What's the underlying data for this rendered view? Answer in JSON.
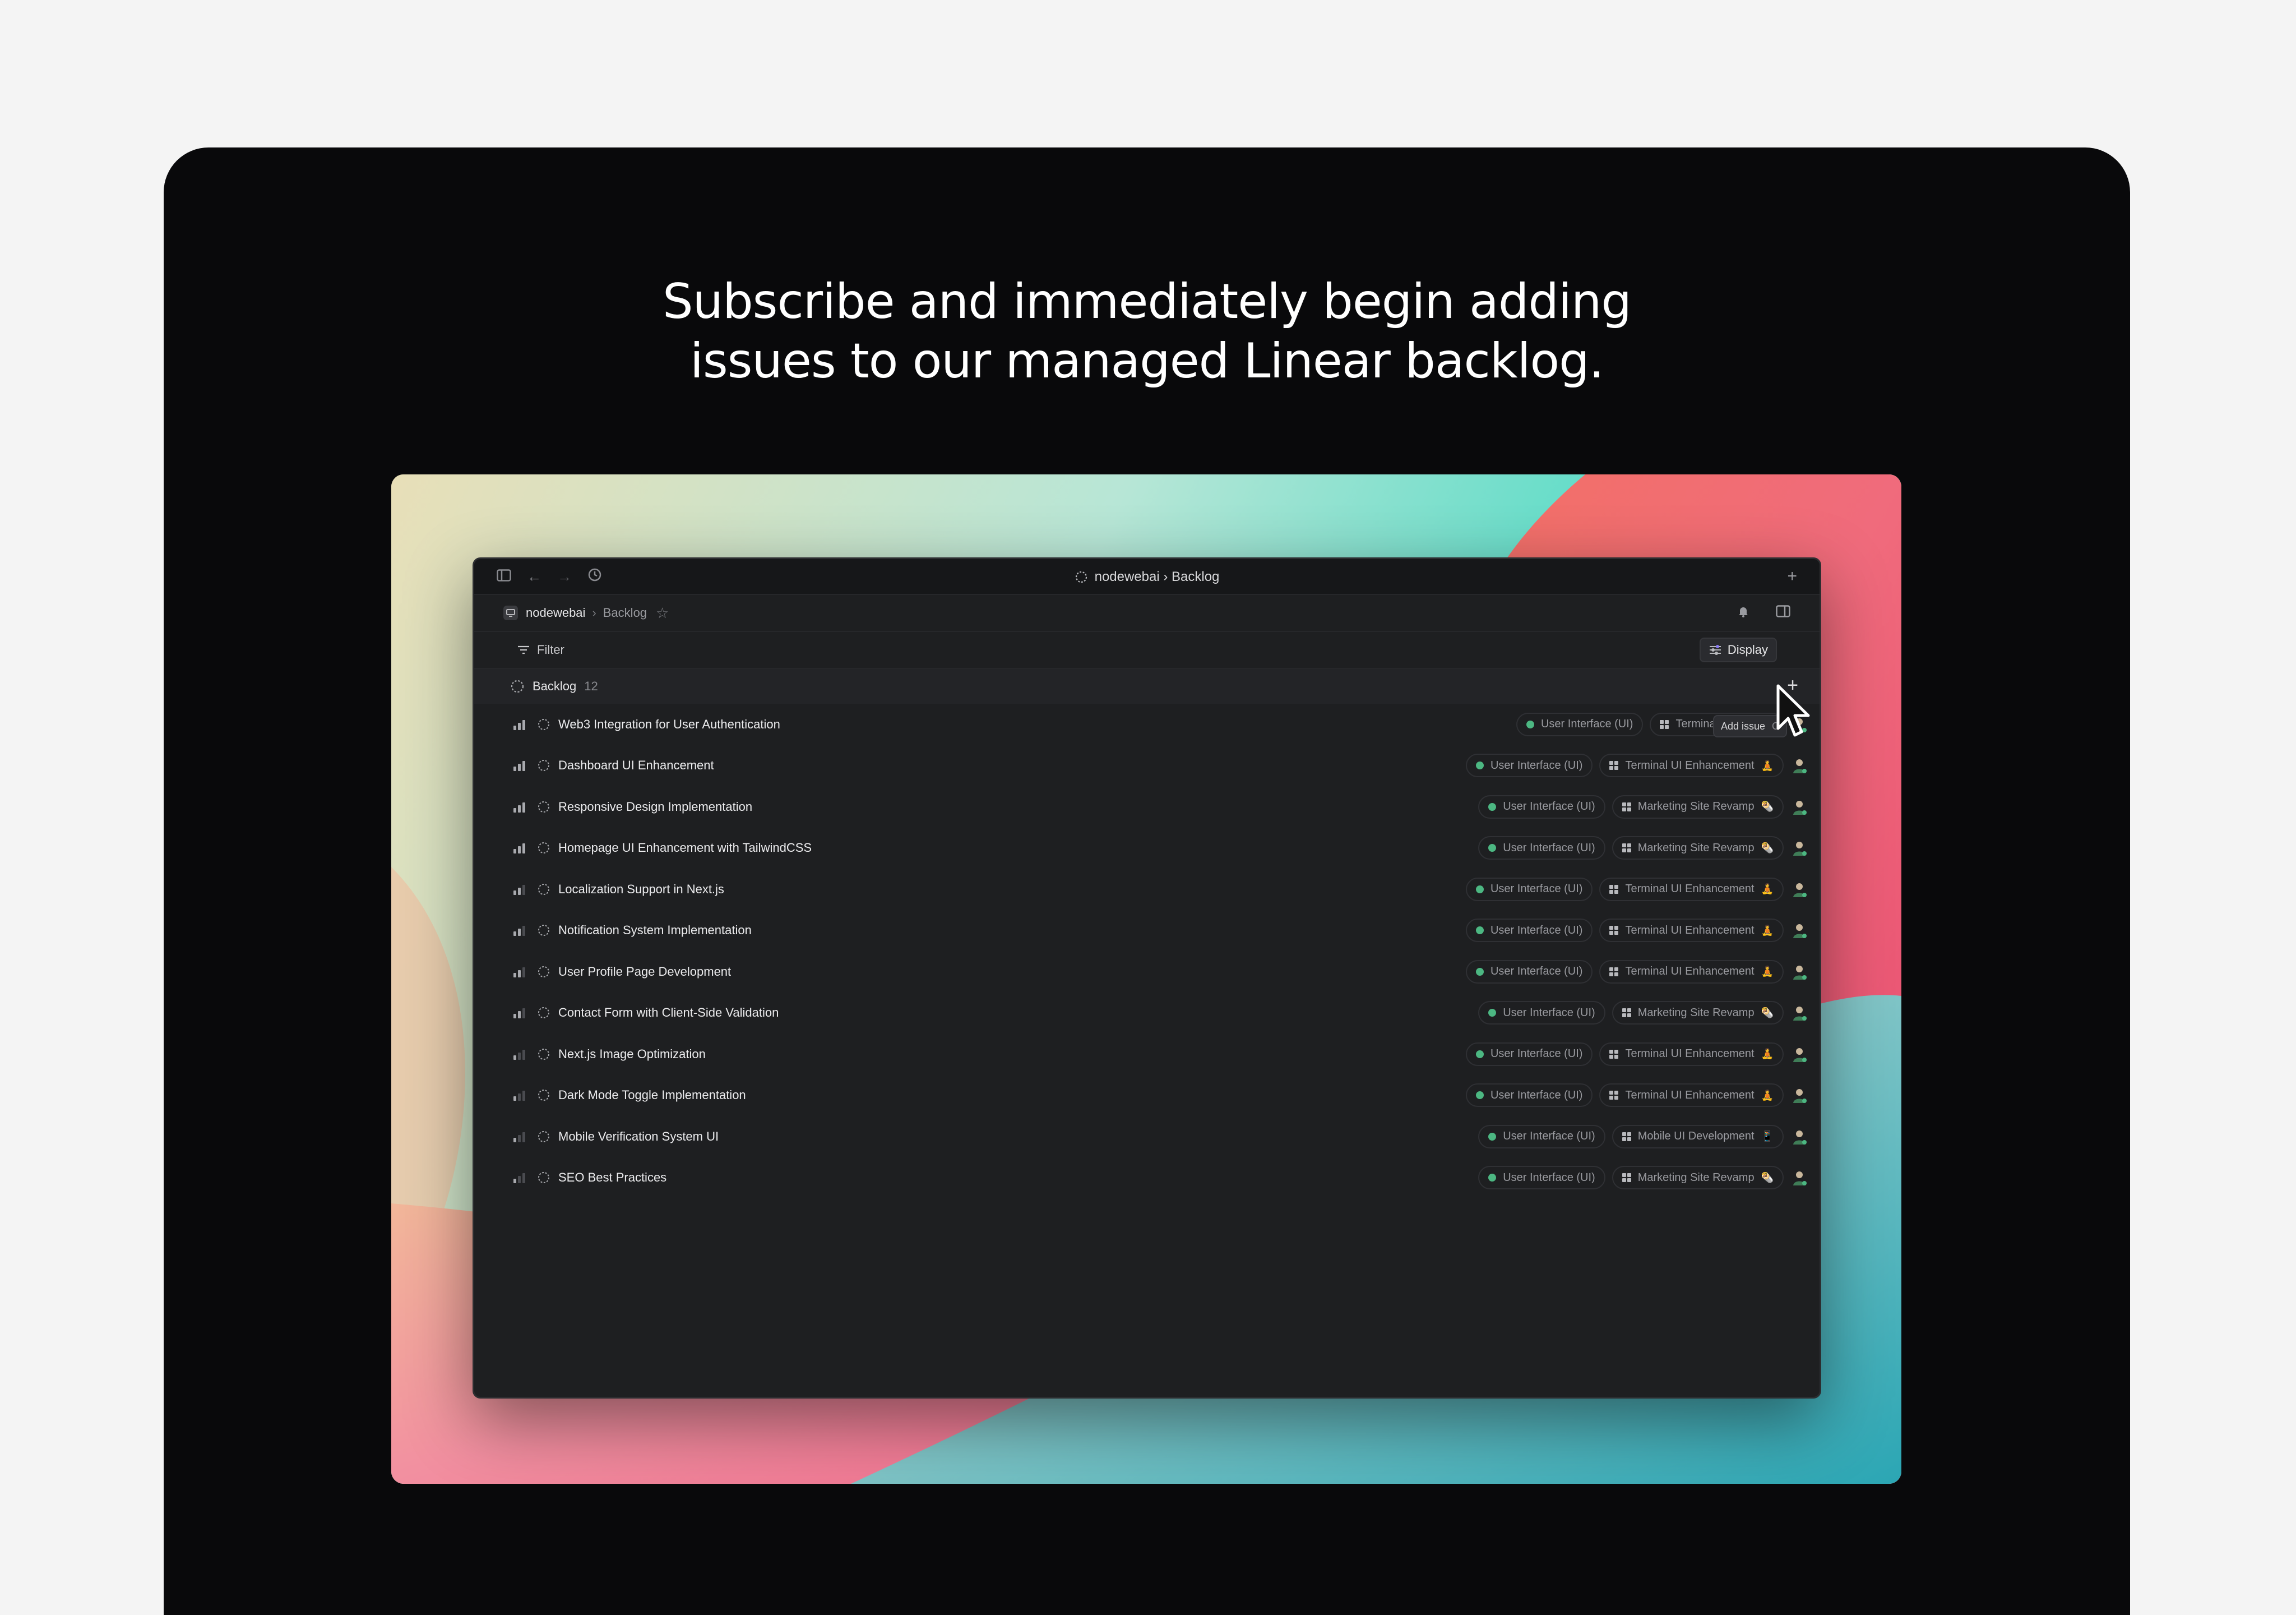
{
  "headline": {
    "line1": "Subscribe and immediately begin adding",
    "line2": "issues to our managed Linear backlog."
  },
  "window": {
    "title": "nodewebai › Backlog",
    "breadcrumb": {
      "workspace": "nodewebai",
      "separator": "›",
      "page": "Backlog"
    },
    "filter_label": "Filter",
    "display_label": "Display",
    "tooltip": {
      "label": "Add issue",
      "shortcut": "C"
    }
  },
  "group": {
    "name": "Backlog",
    "count": "12"
  },
  "colors": {
    "label_dot": "#4cb782",
    "accent_orange": "#f29b2f",
    "window_bg": "#1e1f21"
  },
  "issues": [
    {
      "title": "Web3 Integration for User Authentication",
      "label": "User Interface (UI)",
      "project": "Terminal UI Enhanc",
      "emoji": "",
      "priority_bars": 3
    },
    {
      "title": "Dashboard UI Enhancement",
      "label": "User Interface (UI)",
      "project": "Terminal UI Enhancement",
      "emoji": "🧘",
      "priority_bars": 3
    },
    {
      "title": "Responsive Design Implementation",
      "label": "User Interface (UI)",
      "project": "Marketing Site Revamp",
      "emoji": "🌯",
      "priority_bars": 3
    },
    {
      "title": "Homepage UI Enhancement with TailwindCSS",
      "label": "User Interface (UI)",
      "project": "Marketing Site Revamp",
      "emoji": "🌯",
      "priority_bars": 3
    },
    {
      "title": "Localization Support in Next.js",
      "label": "User Interface (UI)",
      "project": "Terminal UI Enhancement",
      "emoji": "🧘",
      "priority_bars": 2
    },
    {
      "title": "Notification System Implementation",
      "label": "User Interface (UI)",
      "project": "Terminal UI Enhancement",
      "emoji": "🧘",
      "priority_bars": 2
    },
    {
      "title": "User Profile Page Development",
      "label": "User Interface (UI)",
      "project": "Terminal UI Enhancement",
      "emoji": "🧘",
      "priority_bars": 2
    },
    {
      "title": "Contact Form with Client-Side Validation",
      "label": "User Interface (UI)",
      "project": "Marketing Site Revamp",
      "emoji": "🌯",
      "priority_bars": 2
    },
    {
      "title": "Next.js Image Optimization",
      "label": "User Interface (UI)",
      "project": "Terminal UI Enhancement",
      "emoji": "🧘",
      "priority_bars": 1
    },
    {
      "title": "Dark Mode Toggle Implementation",
      "label": "User Interface (UI)",
      "project": "Terminal UI Enhancement",
      "emoji": "🧘",
      "priority_bars": 1
    },
    {
      "title": "Mobile Verification System UI",
      "label": "User Interface (UI)",
      "project": "Mobile UI Development",
      "emoji": "📱",
      "priority_bars": 1
    },
    {
      "title": "SEO Best Practices",
      "label": "User Interface (UI)",
      "project": "Marketing Site Revamp",
      "emoji": "🌯",
      "priority_bars": 1
    }
  ]
}
